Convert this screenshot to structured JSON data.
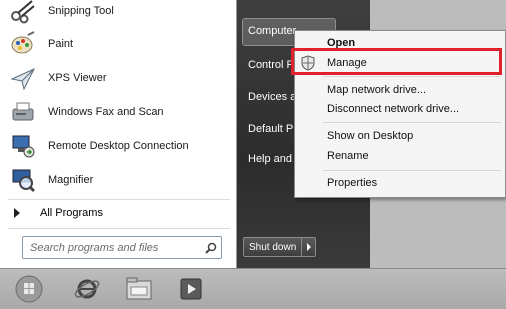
{
  "start_menu": {
    "programs": [
      {
        "label": "Snipping Tool",
        "icon": "scissors-icon"
      },
      {
        "label": "Paint",
        "icon": "paint-palette-icon"
      },
      {
        "label": "XPS Viewer",
        "icon": "paper-plane-icon"
      },
      {
        "label": "Windows Fax and Scan",
        "icon": "fax-scanner-icon"
      },
      {
        "label": "Remote Desktop Connection",
        "icon": "remote-desktop-icon"
      },
      {
        "label": "Magnifier",
        "icon": "magnifier-icon"
      }
    ],
    "all_programs": "All Programs",
    "search_placeholder": "Search programs and files",
    "right_items": [
      "Computer",
      "Control P",
      "Devices an",
      "Default Pr",
      "Help and S"
    ],
    "shutdown_label": "Shut down"
  },
  "context_menu": {
    "items": [
      "Open",
      "Manage",
      "Map network drive...",
      "Disconnect network drive...",
      "Show on Desktop",
      "Rename",
      "Properties"
    ],
    "highlighted": "Manage",
    "highlight_color": "#e0202a"
  },
  "taskbar": {
    "icons": [
      "start-orb-icon",
      "internet-explorer-icon",
      "file-explorer-icon",
      "media-player-icon"
    ]
  }
}
